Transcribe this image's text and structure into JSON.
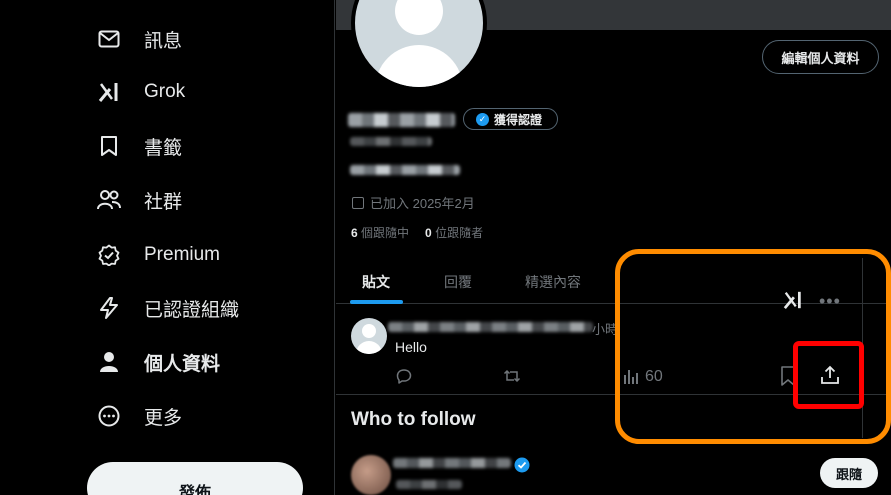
{
  "sidebar": {
    "items": [
      {
        "label": "訊息",
        "icon": "envelope-icon"
      },
      {
        "label": "Grok",
        "icon": "grok-icon"
      },
      {
        "label": "書籤",
        "icon": "bookmark-icon"
      },
      {
        "label": "社群",
        "icon": "communities-icon"
      },
      {
        "label": "Premium",
        "icon": "premium-icon"
      },
      {
        "label": "已認證組織",
        "icon": "lightning-icon"
      },
      {
        "label": "個人資料",
        "icon": "person-icon",
        "active": true
      },
      {
        "label": "更多",
        "icon": "more-circle-icon"
      }
    ],
    "post_button": "發佈"
  },
  "profile": {
    "edit_button": "編輯個人資料",
    "verify_badge": "獲得認證",
    "joined": "已加入 2025年2月",
    "following_count": "6",
    "following_label": "個跟隨中",
    "followers_count": "0",
    "followers_label": "位跟隨者"
  },
  "tabs": [
    {
      "label": "貼文",
      "active": true
    },
    {
      "label": "回覆"
    },
    {
      "label": "精選內容"
    }
  ],
  "tweet": {
    "time": "小時",
    "text": "Hello",
    "views": "60"
  },
  "who_to_follow": {
    "title": "Who to follow",
    "follow_button": "跟隨"
  },
  "colors": {
    "accent": "#1d9bf0",
    "highlight_outer": "#ff8c00",
    "highlight_inner": "#ff0000"
  }
}
